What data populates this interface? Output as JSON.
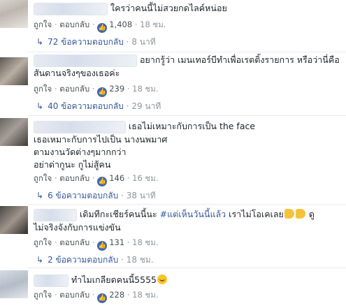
{
  "actions": {
    "like_label": "ถูกใจ",
    "reply_label": "ตอบกลับ",
    "separator": "·",
    "like_icon": "thumbs-up-icon",
    "replies_arrow_icon": "reply-arrow-icon"
  },
  "comments": [
    {
      "text_lines": [
        "ใครว่าคนนี้ไม่สวยกดไลค์หน่อย"
      ],
      "likes": "1,408",
      "time": "18 ชม.",
      "replies": "72 ข้อความตอบกลับ",
      "replies_time": "8 นาที"
    },
    {
      "text_lines": [
        "อยากรู้ว่า เมนเทอร์บีทำเพื่อเรตติ้งรายการ หรือว่านี่คือ",
        "สันดานจริงๆของเธอค่ะ"
      ],
      "likes": "239",
      "time": "18 ชม.",
      "replies": "40 ข้อความตอบกลับ",
      "replies_time": "29 นาที"
    },
    {
      "text_lines": [
        "เธอไม่เหมาะกับการเป็น the face",
        "เธอเหมาะกับการไปเป็น นางนพมาศ",
        "ตามงานวัดต่างๆมากกว่า",
        "อย่าด่ากูนะ กูไม่สู้คน"
      ],
      "likes": "146",
      "time": "16 ชม.",
      "replies": "6 ข้อความตอบกลับ",
      "replies_time": "38 นาที"
    },
    {
      "text_before": "เดิมทีกะเชียร์คนนี้นะ ",
      "hashtag": "#แต่เห็นวันนี้แล้ว",
      "text_after": " เราไม่โอเคเลย",
      "text_end": "ดู",
      "text_line2": "ไม่จริงจังกับการแข่งขัน",
      "likes": "131",
      "time": "18 ชม.",
      "replies": "2 ข้อความตอบกลับ",
      "replies_time": "18 ชม."
    },
    {
      "text_lines": [
        "ทำไมเกลียดคนนี้5555"
      ],
      "likes": "228",
      "time": "18 ชม."
    }
  ]
}
